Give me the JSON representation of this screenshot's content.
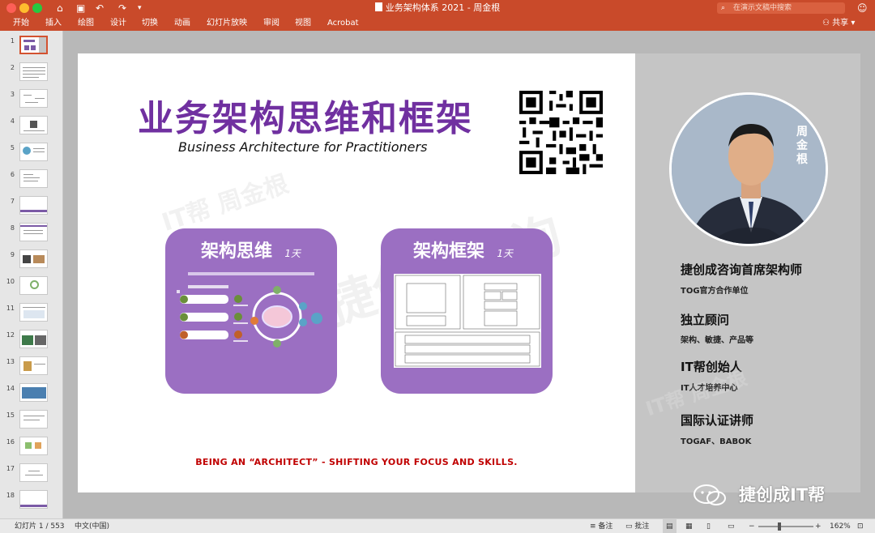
{
  "titlebar": {
    "doc_title": "业务架构体系 2021 - 周金根",
    "search_placeholder": "在演示文稿中搜索",
    "colors": {
      "red": "#fd5f57",
      "yellow": "#febc2e",
      "green": "#28c840"
    }
  },
  "ribbon": {
    "tabs": [
      "开始",
      "插入",
      "绘图",
      "设计",
      "切换",
      "动画",
      "幻灯片放映",
      "审阅",
      "视图",
      "Acrobat"
    ],
    "share_label": "共享"
  },
  "thumbnails": [
    "1",
    "2",
    "3",
    "4",
    "5",
    "6",
    "7",
    "8",
    "9",
    "10",
    "11",
    "12",
    "13",
    "14",
    "15",
    "16",
    "17",
    "18"
  ],
  "slide": {
    "title": "业务架构思维和框架",
    "subtitle": "Business Architecture for Practitioners",
    "watermark_1": "IT帮 周金根",
    "watermark_2": "捷创成咨询",
    "watermark_3": "IT帮 周金根",
    "card_left": {
      "title": "架构思维",
      "duration": "1天"
    },
    "card_right": {
      "title": "架构框架",
      "duration": "1天"
    },
    "slogan": "BEING AN “ARCHITECT” - SHIFTING YOUR FOCUS AND SKILLS.",
    "avatar_name": "周金根",
    "roles": [
      {
        "heading": "捷创成咨询首席架构师",
        "sub": "TOG官方合作单位"
      },
      {
        "heading": "独立顾问",
        "sub": "架构、敏捷、产品等"
      },
      {
        "heading": "IT帮创始人",
        "sub": "IT人才培养中心"
      },
      {
        "heading": "国际认证讲师",
        "sub": "TOGAF、BABOK"
      }
    ]
  },
  "statusbar": {
    "slide_counter": "幻灯片 1 / 553",
    "language": "中文(中国)",
    "notes_label": "备注",
    "comments_label": "批注",
    "zoom": "162%"
  },
  "overlay": {
    "brand": "捷创成IT帮"
  },
  "colors": {
    "accent": "#c94a2a",
    "purple": "#7030a0",
    "card": "#9b6fc2",
    "slogan": "#c00000"
  }
}
